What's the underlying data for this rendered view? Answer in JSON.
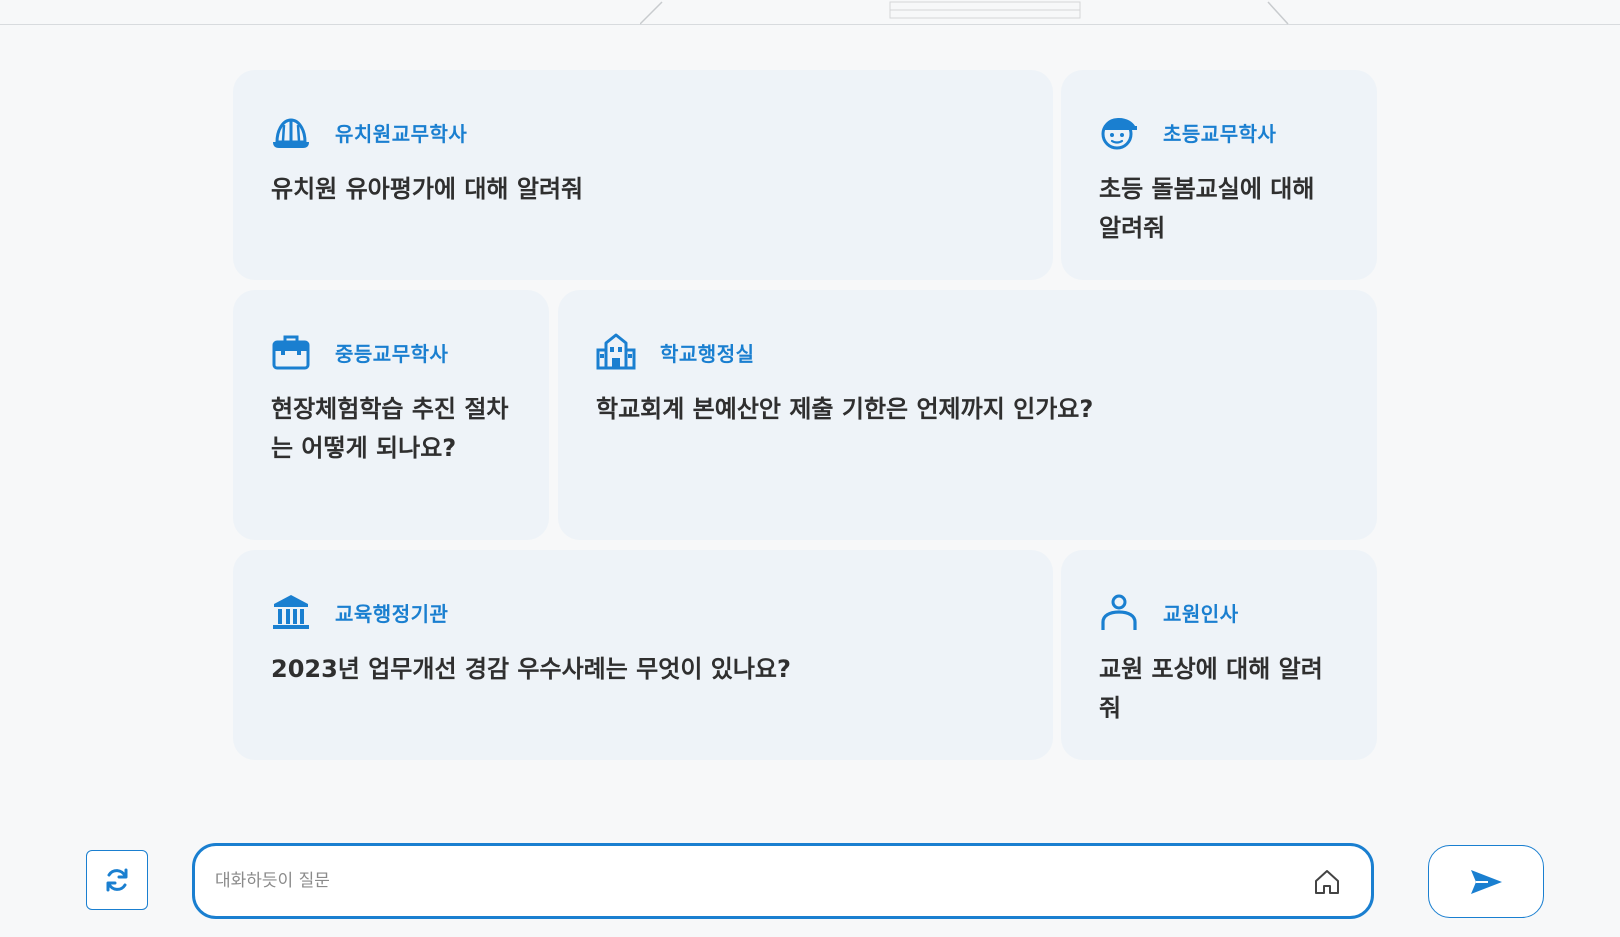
{
  "cards": [
    {
      "icon": "hard-hat-icon",
      "category": "유치원교무학사",
      "question": "유치원 유아평가에 대해 알려줘"
    },
    {
      "icon": "student-cap-icon",
      "category": "초등교무학사",
      "question": "초등 돌봄교실에 대해 알려줘"
    },
    {
      "icon": "briefcase-icon",
      "category": "중등교무학사",
      "question": "현장체험학습 추진 절차는 어떻게 되나요?"
    },
    {
      "icon": "school-building-icon",
      "category": "학교행정실",
      "question": "학교회계 본예산안 제출 기한은 언제까지 인가요?"
    },
    {
      "icon": "government-building-icon",
      "category": "교육행정기관",
      "question": "2023년 업무개선 경감 우수사례는 무엇이 있나요?"
    },
    {
      "icon": "person-icon",
      "category": "교원인사",
      "question": "교원 포상에 대해 알려줘"
    }
  ],
  "input": {
    "placeholder": "대화하듯이 질문",
    "value": ""
  },
  "buttons": {
    "refresh_icon": "refresh-icon",
    "home_icon": "home-icon",
    "send_icon": "send-icon"
  },
  "colors": {
    "accent": "#1a7fd0",
    "card_bg": "#eef3f8",
    "page_bg": "#f7f8f9",
    "text": "#2f2f2f"
  }
}
